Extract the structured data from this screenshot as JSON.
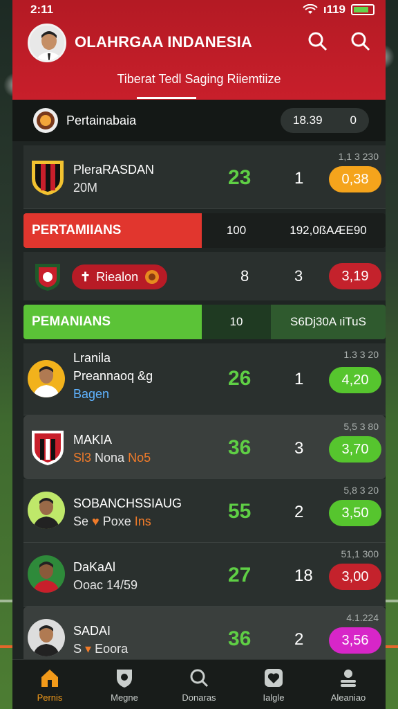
{
  "status": {
    "time": "2:11",
    "signal": "ı119"
  },
  "header": {
    "title": "OLAHRGAA INDANESIA",
    "subtitle": "Tiberat Tedl Saging Riiemtiize"
  },
  "league": {
    "name": "Pertainabaia",
    "value": "18.39",
    "extra": "0"
  },
  "rows_top": [
    {
      "name": "PleraRASDAN",
      "sub": "20M",
      "pts": "23",
      "num": "1",
      "small": "1,1 3 230",
      "badge": "0,38",
      "badge_color": "#f5a41c"
    }
  ],
  "section1": {
    "title": "PERTAMIIANS",
    "mid": "100",
    "right": "192,0ßAÆE90"
  },
  "mini_row": {
    "pill": "Riealon",
    "n1": "8",
    "n2": "3",
    "badge": "3,19"
  },
  "section2": {
    "title": "PEMANIANS",
    "mid": "10",
    "right": "S6Dj30A ıiTuS"
  },
  "rows": [
    {
      "name1": "Lranila",
      "name2": "Preannaoq &g",
      "sub": "Bagen",
      "pts": "26",
      "num": "1",
      "small": "1.3 3 20",
      "badge": "4,20",
      "badge_color": "#56c52e"
    },
    {
      "name1": "MAKIA",
      "sub_a": "Sl3",
      "sub_b": "Nona",
      "sub_c": "No5",
      "pts": "36",
      "num": "3",
      "small": "5,5 3 80",
      "badge": "3,70",
      "badge_color": "#56c52e"
    },
    {
      "name1": "SOBANCHSSIAUG",
      "sub_a": "Se",
      "sub_b": "Poxe",
      "sub_c": "Ins",
      "pts": "55",
      "num": "2",
      "small": "5,8 3 20",
      "badge": "3,50",
      "badge_color": "#56c52e"
    },
    {
      "name1": "DaKaAl",
      "sub": "Ooac 14/59",
      "pts": "27",
      "num": "18",
      "small": "51,1 300",
      "badge": "3,00",
      "badge_color": "#c4222c"
    },
    {
      "name1": "SADAI",
      "sub_a": "S",
      "sub_b": "Eoora",
      "pts": "36",
      "num": "2",
      "small": "4.1.224",
      "badge": "3,56",
      "badge_color": "#d726c8"
    }
  ],
  "nav": [
    {
      "label": "Pernis",
      "icon": "home-icon"
    },
    {
      "label": "Megne",
      "icon": "shield-icon"
    },
    {
      "label": "Donaras",
      "icon": "search-icon"
    },
    {
      "label": "Ialgle",
      "icon": "heart-icon"
    },
    {
      "label": "Aleaniao",
      "icon": "profile-icon"
    }
  ]
}
